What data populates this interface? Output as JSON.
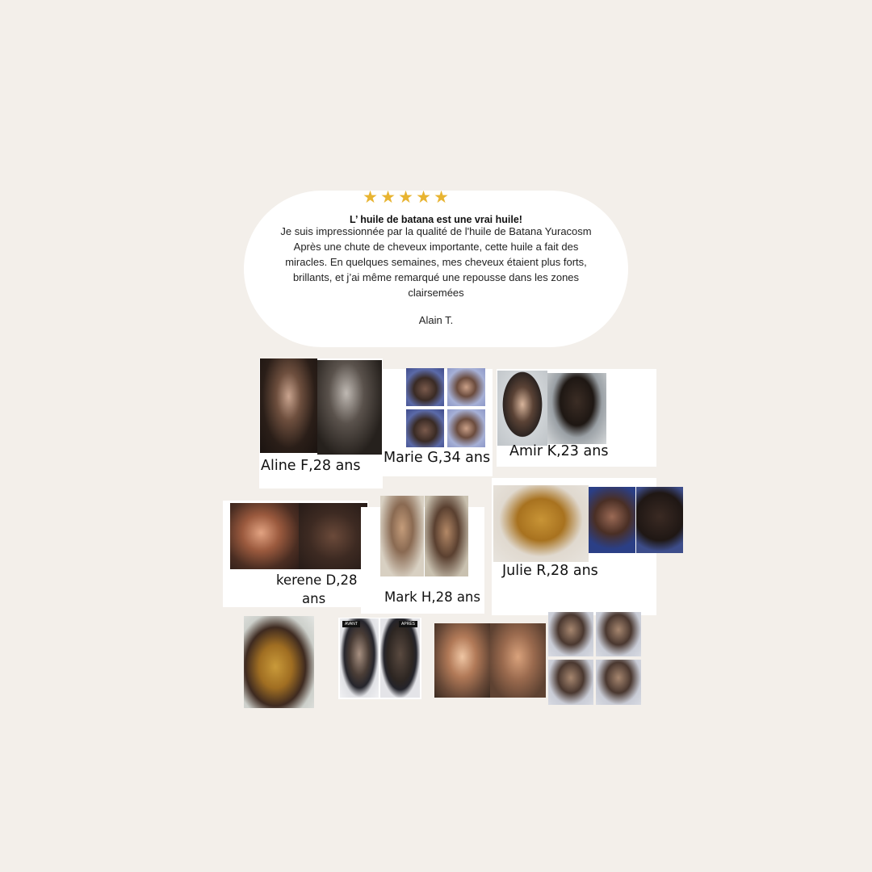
{
  "review": {
    "stars": [
      "★",
      "★",
      "★",
      "★",
      "★"
    ],
    "title": "L’ huile de batana est une vrai huile!",
    "body": "Je suis impressionnée par la qualité de l'huile de Batana Yuracosm\nAprès une chute de cheveux importante, cette huile a fait des miracles. En quelques semaines, mes cheveux étaient plus forts, brillants, et j’ai même remarqué une repousse dans les zones clairsemées",
    "author": "Alain T."
  },
  "testimonials": [
    {
      "caption": "Aline F,28 ans"
    },
    {
      "caption": "Marie G,34 ans"
    },
    {
      "caption": "Amir K,23 ans"
    },
    {
      "caption": "kerene D,28"
    },
    {
      "caption_line2": "ans"
    },
    {
      "caption": "Mark H,28 ans"
    },
    {
      "caption": "Julie R,28 ans"
    }
  ],
  "photo_tags": {
    "before": "AVANT",
    "after": "APRÈS"
  },
  "colors": {
    "background": "#f3efea",
    "card": "#ffffff",
    "star": "#e8b431"
  }
}
